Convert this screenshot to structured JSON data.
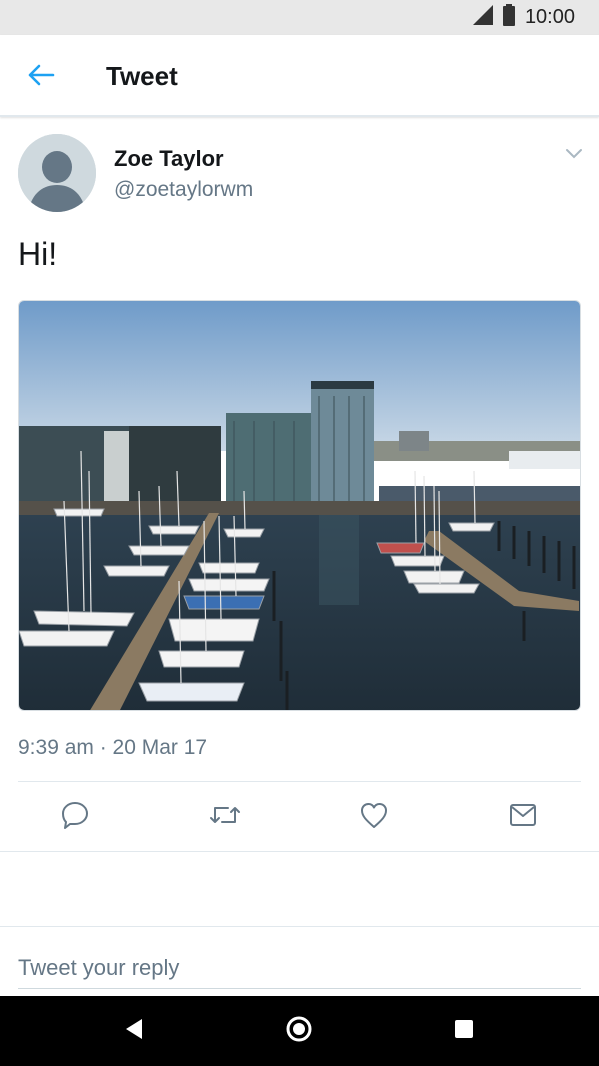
{
  "status_bar": {
    "time": "10:00",
    "icons": [
      "signal-icon",
      "battery-icon"
    ]
  },
  "app_bar": {
    "title": "Tweet",
    "back_icon": "back-arrow-icon"
  },
  "tweet": {
    "author_name": "Zoe Taylor",
    "author_handle": "@zoetaylorwm",
    "text": "Hi!",
    "timestamp": "9:39 am · 20 Mar 17",
    "photo": "marina-photo"
  },
  "actions": [
    {
      "name": "reply",
      "icon": "reply-icon"
    },
    {
      "name": "retweet",
      "icon": "retweet-icon"
    },
    {
      "name": "like",
      "icon": "heart-icon"
    },
    {
      "name": "share",
      "icon": "mail-icon"
    }
  ],
  "reply": {
    "placeholder": "Tweet your reply"
  },
  "nav_bar": {
    "buttons": [
      "back-triangle-icon",
      "home-circle-icon",
      "recents-square-icon"
    ]
  },
  "colors": {
    "accent": "#1da1f2",
    "secondary_text": "#657786",
    "icon_gray": "#657786",
    "divider": "#e1e8ed"
  }
}
